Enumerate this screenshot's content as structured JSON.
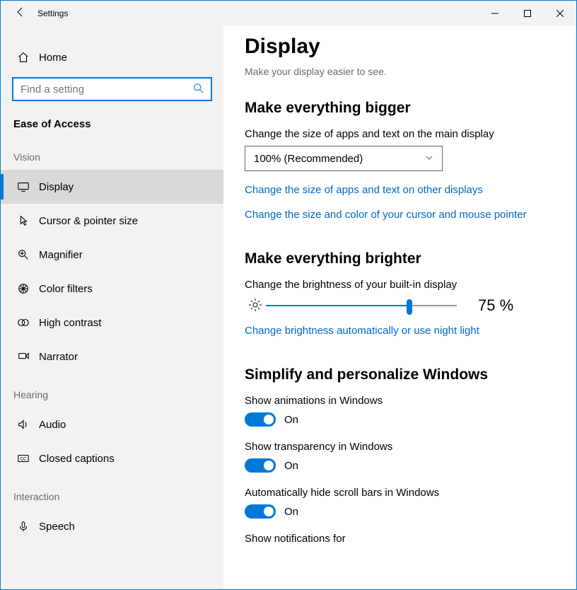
{
  "window": {
    "title": "Settings"
  },
  "sidebar": {
    "home": "Home",
    "search_placeholder": "Find a setting",
    "section": "Ease of Access",
    "groups": {
      "vision": "Vision",
      "hearing": "Hearing",
      "interaction": "Interaction"
    },
    "items": {
      "display": "Display",
      "cursor": "Cursor & pointer size",
      "magnifier": "Magnifier",
      "color_filters": "Color filters",
      "high_contrast": "High contrast",
      "narrator": "Narrator",
      "audio": "Audio",
      "closed_captions": "Closed captions",
      "speech": "Speech"
    }
  },
  "page": {
    "title": "Display",
    "subtitle": "Make your display easier to see.",
    "bigger": {
      "heading": "Make everything bigger",
      "label": "Change the size of apps and text on the main display",
      "select_value": "100% (Recommended)",
      "link1": "Change the size of apps and text on other displays",
      "link2": "Change the size and color of your cursor and mouse pointer"
    },
    "brighter": {
      "heading": "Make everything brighter",
      "label": "Change the brightness of your built-in display",
      "value_text": "75 %",
      "value_pct": 75,
      "link": "Change brightness automatically or use night light"
    },
    "simplify": {
      "heading": "Simplify and personalize Windows",
      "animations_label": "Show animations in Windows",
      "animations_state": "On",
      "transparency_label": "Show transparency in Windows",
      "transparency_state": "On",
      "scroll_label": "Automatically hide scroll bars in Windows",
      "scroll_state": "On",
      "notifications_label": "Show notifications for"
    }
  }
}
